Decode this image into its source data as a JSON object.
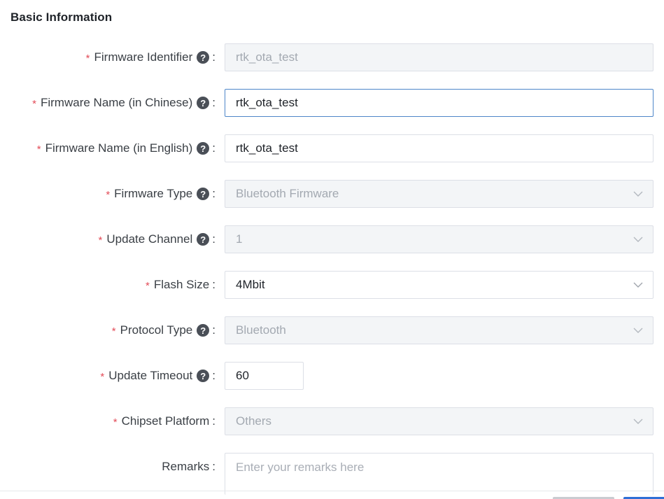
{
  "section": {
    "title": "Basic Information"
  },
  "icons": {
    "help": "?",
    "required": "*",
    "colon": ":"
  },
  "colors": {
    "required": "#e34d59",
    "focus_border": "#4e86c9",
    "disabled_bg": "#f3f5f7"
  },
  "fields": {
    "firmware_identifier": {
      "label": "Firmware Identifier",
      "value": "rtk_ota_test"
    },
    "firmware_name_cn": {
      "label": "Firmware Name (in Chinese)",
      "value": "rtk_ota_test"
    },
    "firmware_name_en": {
      "label": "Firmware Name (in English)",
      "value": "rtk_ota_test"
    },
    "firmware_type": {
      "label": "Firmware Type",
      "value": "Bluetooth Firmware"
    },
    "update_channel": {
      "label": "Update Channel",
      "value": "1"
    },
    "flash_size": {
      "label": "Flash Size",
      "value": "4Mbit"
    },
    "protocol_type": {
      "label": "Protocol Type",
      "value": "Bluetooth"
    },
    "update_timeout": {
      "label": "Update Timeout",
      "value": "60"
    },
    "chipset_platform": {
      "label": "Chipset Platform",
      "value": "Others"
    },
    "remarks": {
      "label": "Remarks",
      "placeholder": "Enter your remarks here"
    }
  }
}
